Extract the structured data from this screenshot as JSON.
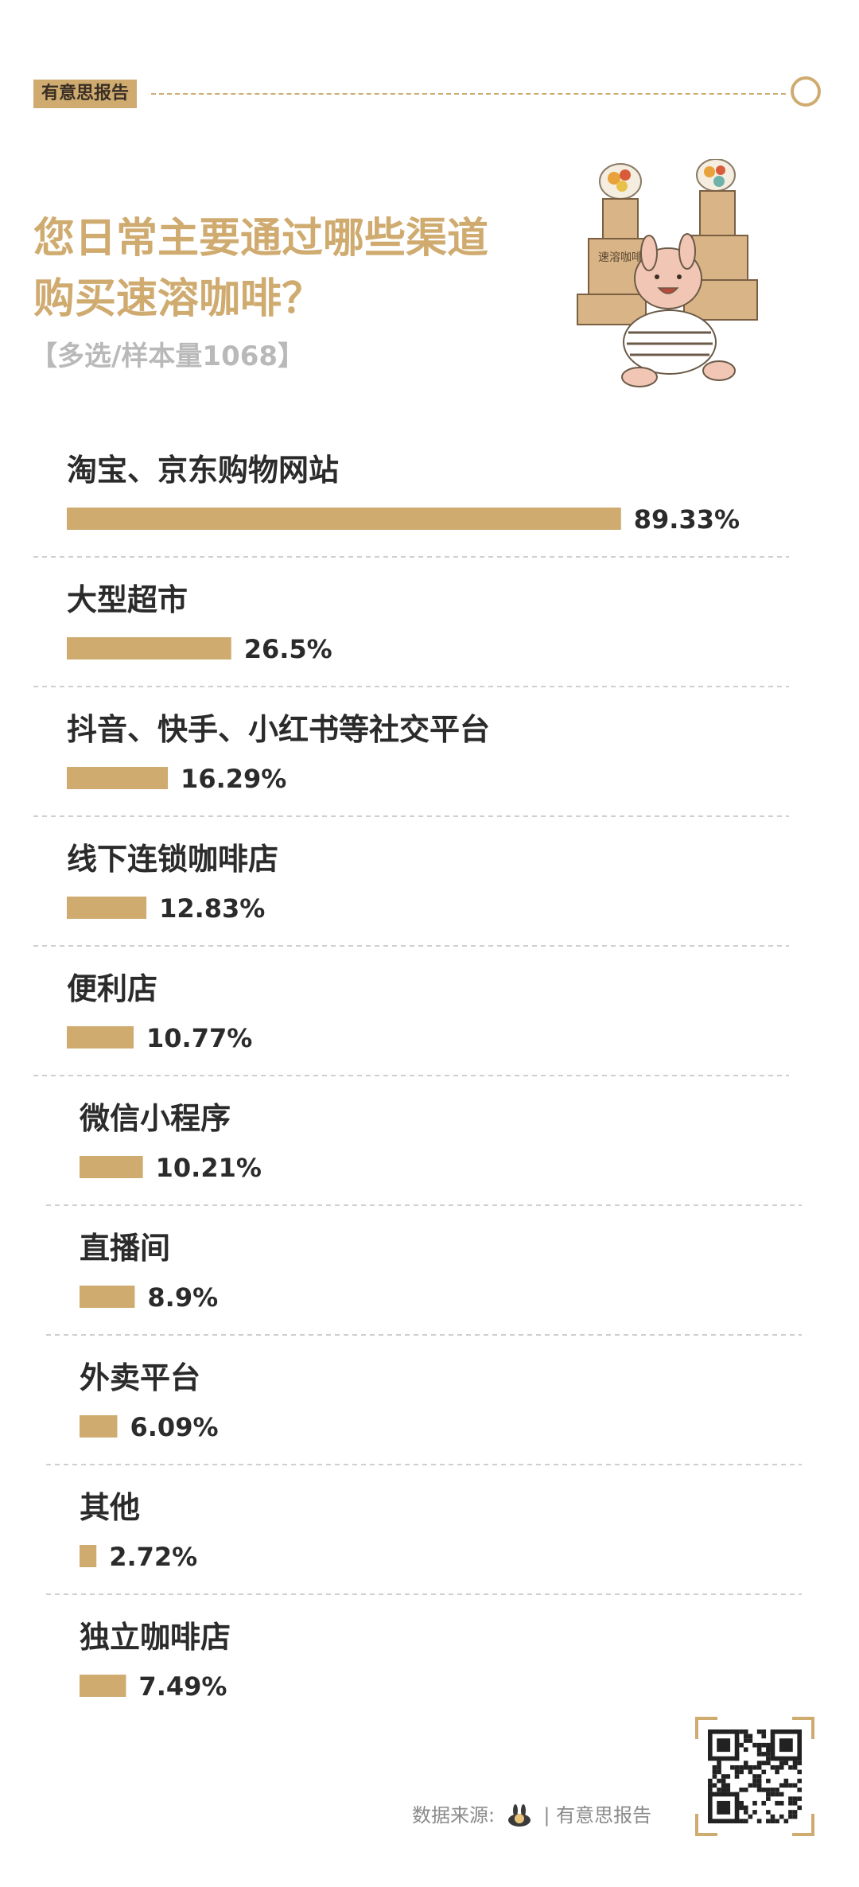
{
  "header": {
    "brand_tag": "有意思报告",
    "accent_color": "#CFAB70"
  },
  "title": {
    "line1": "您日常主要通过哪些渠道",
    "line2": "购买速溶咖啡？"
  },
  "subtitle": "【多选/样本量1068】",
  "mascot": {
    "icon": "mascot-carrying-coffee-boxes-icon",
    "box_text": "速溶咖啡"
  },
  "chart_data": {
    "type": "bar",
    "orientation": "horizontal",
    "unit": "%",
    "categories": [
      "淘宝、京东购物网站",
      "大型超市",
      "抖音、快手、小红书等社交平台",
      "线下连锁咖啡店",
      "便利店",
      "微信小程序",
      "直播间",
      "外卖平台",
      "其他",
      "独立咖啡店"
    ],
    "values": [
      89.33,
      26.5,
      16.29,
      12.83,
      10.77,
      10.21,
      8.9,
      6.09,
      2.72,
      7.49
    ],
    "value_labels": [
      "89.33%",
      "26.5%",
      "16.29%",
      "12.83%",
      "10.77%",
      "10.21%",
      "8.9%",
      "6.09%",
      "2.72%",
      "7.49%"
    ],
    "bar_color": "#CFAB70"
  },
  "footer": {
    "source_label": "数据来源:",
    "source_name": "有意思报告",
    "qr_icon": "qr-code-icon"
  }
}
